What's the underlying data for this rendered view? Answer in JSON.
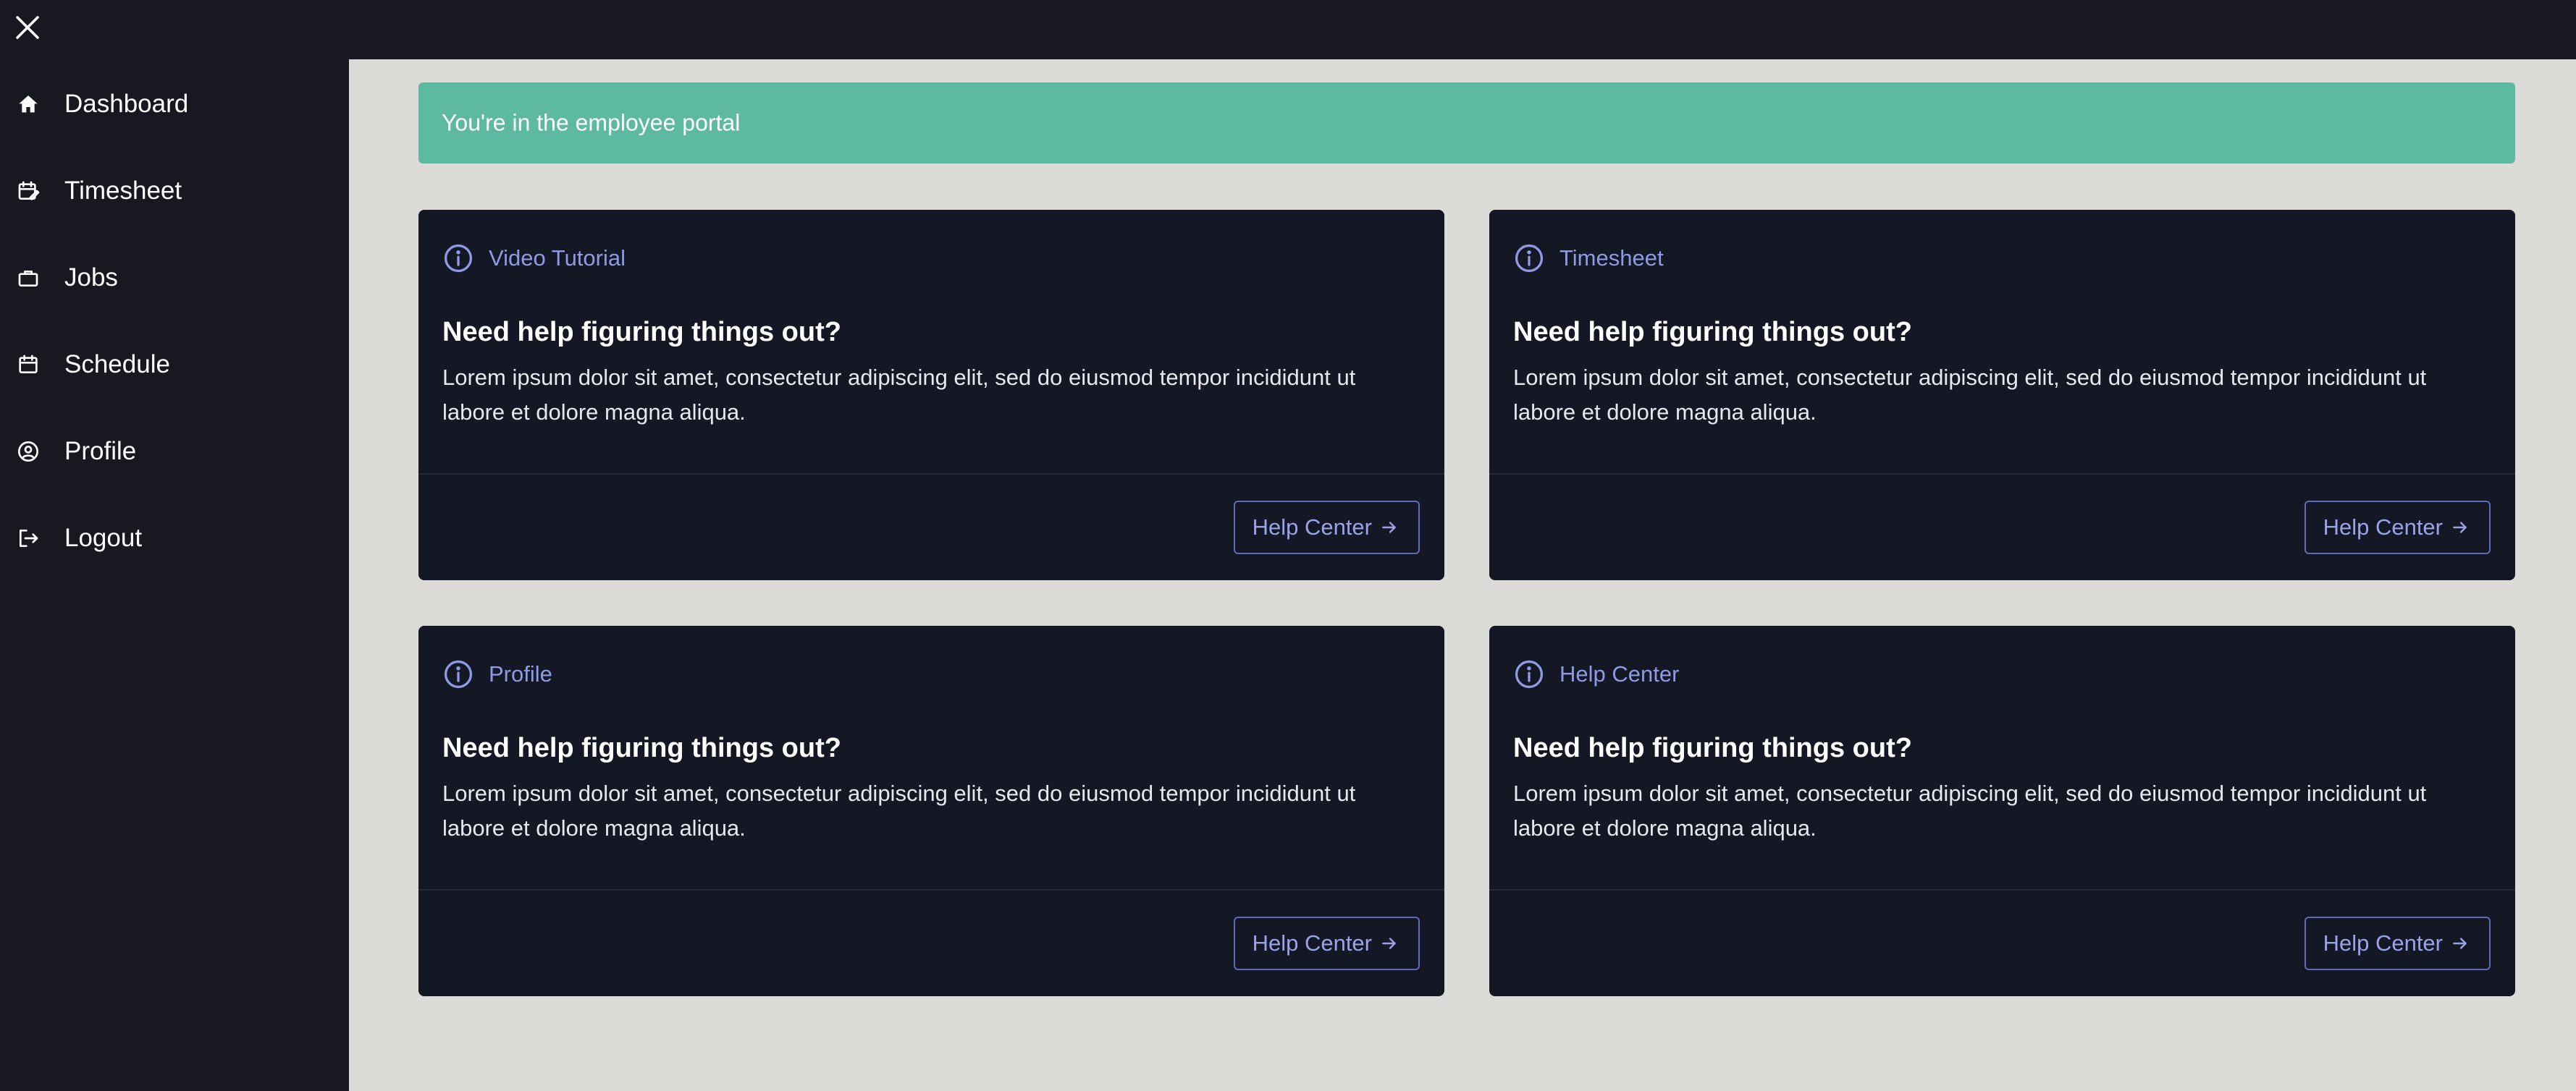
{
  "topbar": {
    "close_icon": "close-icon"
  },
  "sidebar": {
    "items": [
      {
        "label": "Dashboard",
        "icon": "home-icon"
      },
      {
        "label": "Timesheet",
        "icon": "calendar-edit-icon"
      },
      {
        "label": "Jobs",
        "icon": "briefcase-icon"
      },
      {
        "label": "Schedule",
        "icon": "calendar-icon"
      },
      {
        "label": "Profile",
        "icon": "user-circle-icon"
      },
      {
        "label": "Logout",
        "icon": "logout-icon"
      }
    ]
  },
  "banner": {
    "text": "You're in the employee portal",
    "color": "#5db99f"
  },
  "cards": [
    {
      "tag": "Video Tutorial",
      "title": "Need help figuring things out?",
      "body": "Lorem ipsum dolor sit amet, consectetur adipiscing elit, sed do eiusmod tempor incididunt ut labore et dolore magna aliqua.",
      "button": "Help Center"
    },
    {
      "tag": "Timesheet",
      "title": "Need help figuring things out?",
      "body": "Lorem ipsum dolor sit amet, consectetur adipiscing elit, sed do eiusmod tempor incididunt ut labore et dolore magna aliqua.",
      "button": "Help Center"
    },
    {
      "tag": "Profile",
      "title": "Need help figuring things out?",
      "body": "Lorem ipsum dolor sit amet, consectetur adipiscing elit, sed do eiusmod tempor incididunt ut labore et dolore magna aliqua.",
      "button": "Help Center"
    },
    {
      "tag": "Help Center",
      "title": "Need help figuring things out?",
      "body": "Lorem ipsum dolor sit amet, consectetur adipiscing elit, sed do eiusmod tempor incididunt ut labore et dolore magna aliqua.",
      "button": "Help Center"
    }
  ],
  "colors": {
    "sidebar_bg": "#181920",
    "main_bg": "#dddbd8",
    "card_bg": "#141824",
    "accent": "#8f9ae4"
  }
}
